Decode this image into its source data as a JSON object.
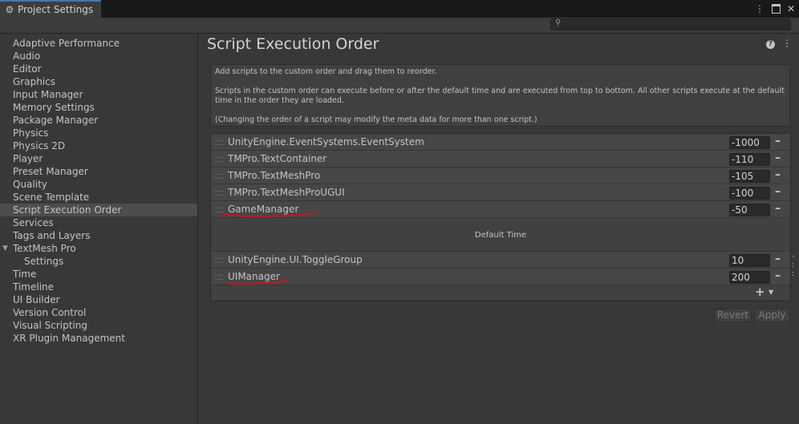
{
  "window": {
    "tab_title": "Project Settings",
    "tab_icon": "gear-icon",
    "controls": [
      "more-vert-icon",
      "maximize-icon",
      "close-icon"
    ]
  },
  "search": {
    "placeholder": "",
    "value": ""
  },
  "sidebar": {
    "items": [
      {
        "label": "Adaptive Performance"
      },
      {
        "label": "Audio"
      },
      {
        "label": "Editor"
      },
      {
        "label": "Graphics"
      },
      {
        "label": "Input Manager"
      },
      {
        "label": "Memory Settings"
      },
      {
        "label": "Package Manager"
      },
      {
        "label": "Physics"
      },
      {
        "label": "Physics 2D"
      },
      {
        "label": "Player"
      },
      {
        "label": "Preset Manager"
      },
      {
        "label": "Quality"
      },
      {
        "label": "Scene Template"
      },
      {
        "label": "Script Execution Order",
        "selected": true
      },
      {
        "label": "Services"
      },
      {
        "label": "Tags and Layers"
      },
      {
        "label": "TextMesh Pro",
        "expanded": true
      },
      {
        "label": "Settings",
        "child": true
      },
      {
        "label": "Time"
      },
      {
        "label": "Timeline"
      },
      {
        "label": "UI Builder"
      },
      {
        "label": "Version Control"
      },
      {
        "label": "Visual Scripting"
      },
      {
        "label": "XR Plugin Management"
      }
    ]
  },
  "main": {
    "title": "Script Execution Order",
    "help": [
      "Add scripts to the custom order and drag them to reorder.",
      "Scripts in the custom order can execute before or after the default time and are executed from top to bottom. All other scripts execute at the default time in the order they are loaded.",
      "(Changing the order of a script may modify the meta data for more than one script.)"
    ],
    "before_default": [
      {
        "name": "UnityEngine.EventSystems.EventSystem",
        "order": "-1000"
      },
      {
        "name": "TMPro.TextContainer",
        "order": "-110"
      },
      {
        "name": "TMPro.TextMeshPro",
        "order": "-105"
      },
      {
        "name": "TMPro.TextMeshProUGUI",
        "order": "-100"
      },
      {
        "name": "GameManager",
        "order": "-50"
      }
    ],
    "default_time_label": "Default Time",
    "after_default": [
      {
        "name": "UnityEngine.UI.ToggleGroup",
        "order": "10"
      },
      {
        "name": "UIManager",
        "order": "200"
      }
    ],
    "revert_label": "Revert",
    "apply_label": "Apply"
  },
  "colors": {
    "background": "#383838",
    "annotation_underline": "#c8181c",
    "tab_accent": "#3a79bb"
  }
}
